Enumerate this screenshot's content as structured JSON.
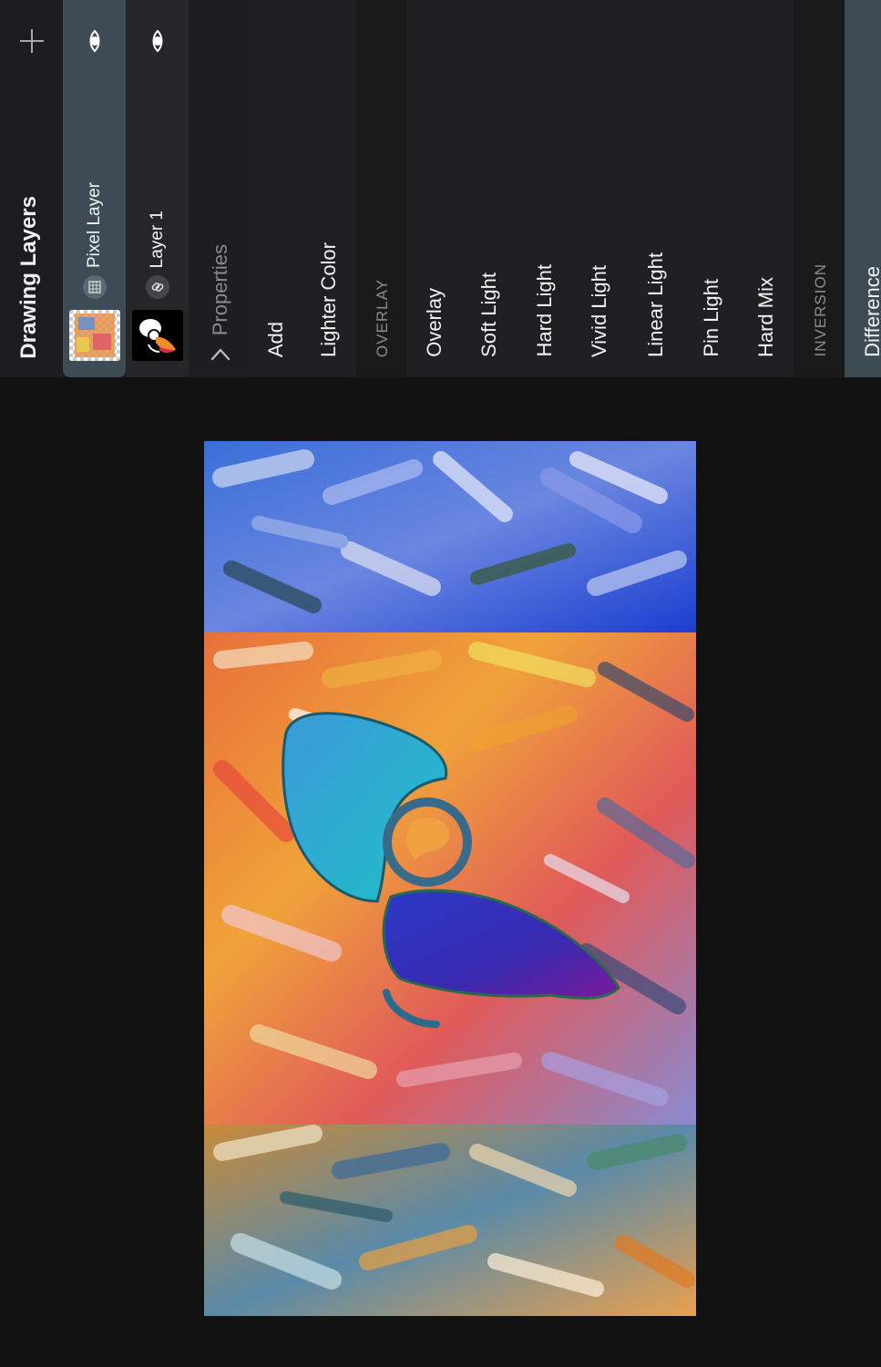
{
  "panel": {
    "title": "Drawing Layers",
    "add_icon": "plus-icon",
    "layers": [
      {
        "name": "Pixel Layer",
        "visibility_icon": "eye-icon",
        "type_icon": "pixel-grid-icon",
        "selected": true
      },
      {
        "name": "Layer 1",
        "visibility_icon": "eye-icon",
        "type_icon": "link-icon",
        "selected": false
      }
    ],
    "properties_label": "Properties",
    "back_icon": "chevron-left-icon",
    "blend_modes": [
      {
        "label": "Add",
        "kind": "item"
      },
      {
        "label": "Lighter Color",
        "kind": "item"
      },
      {
        "label": "OVERLAY",
        "kind": "section"
      },
      {
        "label": "Overlay",
        "kind": "item"
      },
      {
        "label": "Soft Light",
        "kind": "item"
      },
      {
        "label": "Hard Light",
        "kind": "item"
      },
      {
        "label": "Vivid Light",
        "kind": "item"
      },
      {
        "label": "Linear Light",
        "kind": "item"
      },
      {
        "label": "Pin Light",
        "kind": "item"
      },
      {
        "label": "Hard Mix",
        "kind": "item"
      },
      {
        "label": "INVERSION",
        "kind": "section"
      },
      {
        "label": "Difference",
        "kind": "item",
        "selected": true
      }
    ]
  },
  "colors": {
    "panel_bg": "#1c1c1e",
    "selected_bg": "#3d4c54",
    "canvas_bg": "#121212"
  }
}
